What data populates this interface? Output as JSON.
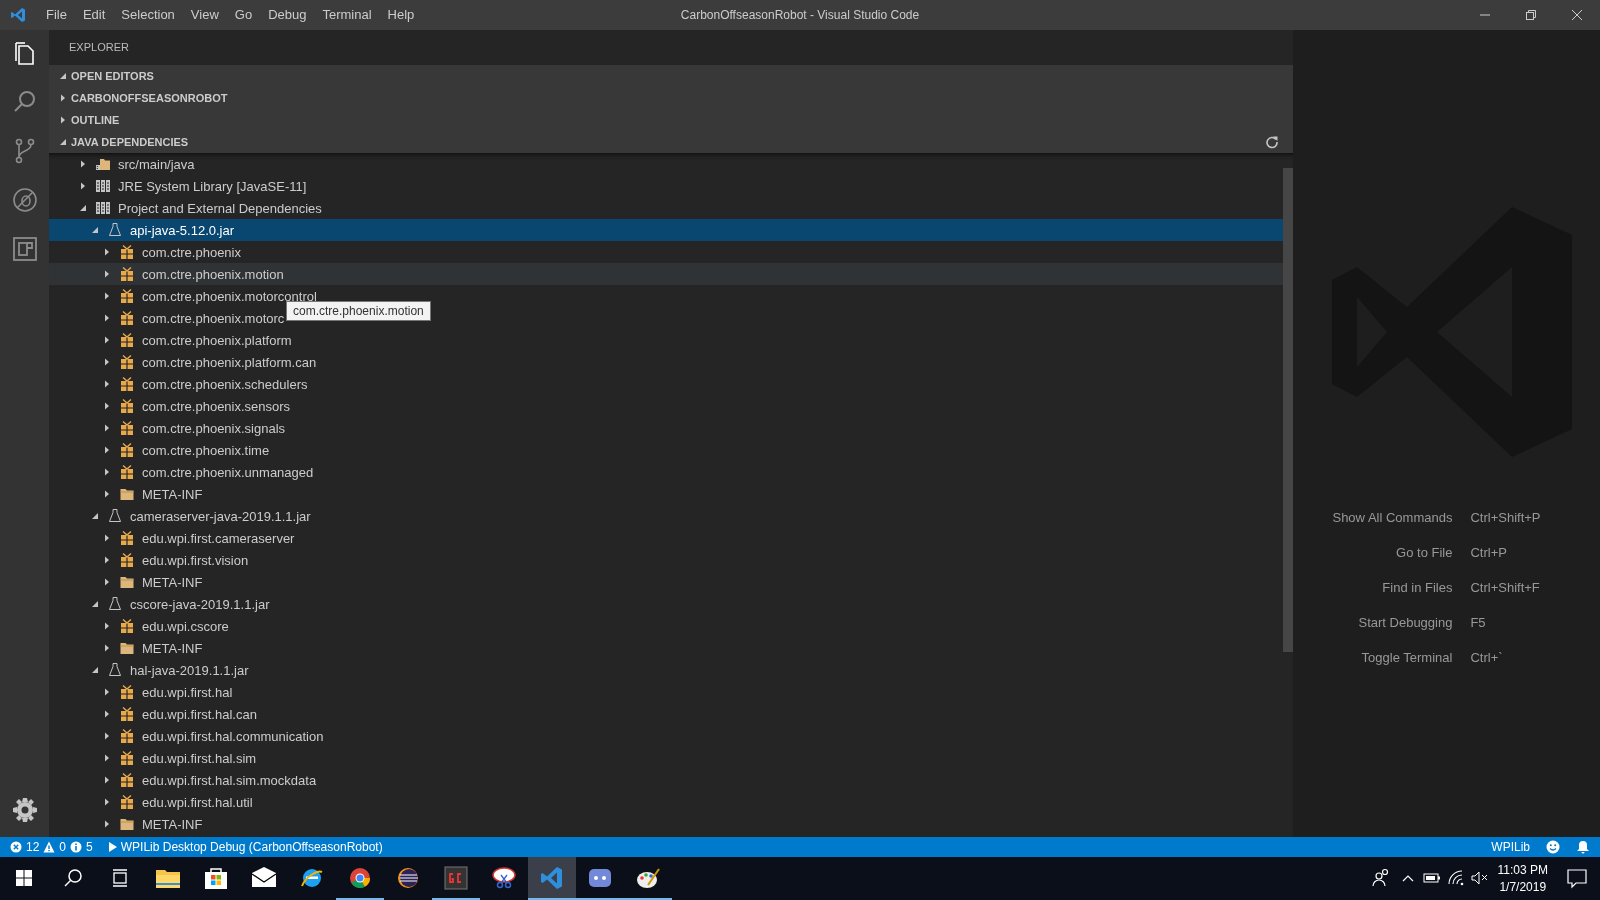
{
  "window": {
    "title": "CarbonOffseasonRobot - Visual Studio Code"
  },
  "menu": [
    "File",
    "Edit",
    "Selection",
    "View",
    "Go",
    "Debug",
    "Terminal",
    "Help"
  ],
  "activity_bar": [
    {
      "kind": "files",
      "selected": true
    },
    {
      "kind": "search",
      "selected": false
    },
    {
      "kind": "scm",
      "selected": false
    },
    {
      "kind": "debug",
      "selected": false
    },
    {
      "kind": "extensions",
      "selected": false
    }
  ],
  "sidebar": {
    "title": "EXPLORER",
    "sections": [
      {
        "label": "OPEN EDITORS",
        "expanded": true
      },
      {
        "label": "CARBONOFFSEASONROBOT",
        "expanded": false
      },
      {
        "label": "OUTLINE",
        "expanded": false
      },
      {
        "label": "JAVA DEPENDENCIES",
        "expanded": true
      }
    ],
    "tree": [
      {
        "label": "src/main/java",
        "kind": "source",
        "expanded": false,
        "selected": false,
        "hovered": false
      },
      {
        "label": "JRE System Library [JavaSE-11]",
        "kind": "library",
        "expanded": false,
        "selected": false,
        "hovered": false
      },
      {
        "label": "Project and External Dependencies",
        "kind": "library",
        "expanded": true,
        "selected": false,
        "hovered": false,
        "children": [
          {
            "label": "api-java-5.12.0.jar",
            "kind": "jar",
            "expanded": true,
            "selected": true,
            "hovered": false,
            "children": [
              {
                "label": "com.ctre.phoenix",
                "kind": "package",
                "expanded": false,
                "selected": false,
                "hovered": false
              },
              {
                "label": "com.ctre.phoenix.motion",
                "kind": "package",
                "expanded": false,
                "selected": false,
                "hovered": true
              },
              {
                "label": "com.ctre.phoenix.motorcontrol",
                "kind": "package",
                "expanded": false,
                "selected": false,
                "hovered": false
              },
              {
                "label": "com.ctre.phoenix.motorc",
                "kind": "package",
                "expanded": false,
                "selected": false,
                "hovered": false
              },
              {
                "label": "com.ctre.phoenix.platform",
                "kind": "package",
                "expanded": false,
                "selected": false,
                "hovered": false
              },
              {
                "label": "com.ctre.phoenix.platform.can",
                "kind": "package",
                "expanded": false,
                "selected": false,
                "hovered": false
              },
              {
                "label": "com.ctre.phoenix.schedulers",
                "kind": "package",
                "expanded": false,
                "selected": false,
                "hovered": false
              },
              {
                "label": "com.ctre.phoenix.sensors",
                "kind": "package",
                "expanded": false,
                "selected": false,
                "hovered": false
              },
              {
                "label": "com.ctre.phoenix.signals",
                "kind": "package",
                "expanded": false,
                "selected": false,
                "hovered": false
              },
              {
                "label": "com.ctre.phoenix.time",
                "kind": "package",
                "expanded": false,
                "selected": false,
                "hovered": false
              },
              {
                "label": "com.ctre.phoenix.unmanaged",
                "kind": "package",
                "expanded": false,
                "selected": false,
                "hovered": false
              },
              {
                "label": "META-INF",
                "kind": "folder",
                "expanded": false,
                "selected": false,
                "hovered": false
              }
            ]
          },
          {
            "label": "cameraserver-java-2019.1.1.jar",
            "kind": "jar",
            "expanded": true,
            "selected": false,
            "hovered": false,
            "children": [
              {
                "label": "edu.wpi.first.cameraserver",
                "kind": "package",
                "expanded": false,
                "selected": false,
                "hovered": false
              },
              {
                "label": "edu.wpi.first.vision",
                "kind": "package",
                "expanded": false,
                "selected": false,
                "hovered": false
              },
              {
                "label": "META-INF",
                "kind": "folder",
                "expanded": false,
                "selected": false,
                "hovered": false
              }
            ]
          },
          {
            "label": "cscore-java-2019.1.1.jar",
            "kind": "jar",
            "expanded": true,
            "selected": false,
            "hovered": false,
            "children": [
              {
                "label": "edu.wpi.cscore",
                "kind": "package",
                "expanded": false,
                "selected": false,
                "hovered": false
              },
              {
                "label": "META-INF",
                "kind": "folder",
                "expanded": false,
                "selected": false,
                "hovered": false
              }
            ]
          },
          {
            "label": "hal-java-2019.1.1.jar",
            "kind": "jar",
            "expanded": true,
            "selected": false,
            "hovered": false,
            "children": [
              {
                "label": "edu.wpi.first.hal",
                "kind": "package",
                "expanded": false,
                "selected": false,
                "hovered": false
              },
              {
                "label": "edu.wpi.first.hal.can",
                "kind": "package",
                "expanded": false,
                "selected": false,
                "hovered": false
              },
              {
                "label": "edu.wpi.first.hal.communication",
                "kind": "package",
                "expanded": false,
                "selected": false,
                "hovered": false
              },
              {
                "label": "edu.wpi.first.hal.sim",
                "kind": "package",
                "expanded": false,
                "selected": false,
                "hovered": false
              },
              {
                "label": "edu.wpi.first.hal.sim.mockdata",
                "kind": "package",
                "expanded": false,
                "selected": false,
                "hovered": false
              },
              {
                "label": "edu.wpi.first.hal.util",
                "kind": "package",
                "expanded": false,
                "selected": false,
                "hovered": false
              },
              {
                "label": "META-INF",
                "kind": "folder",
                "expanded": false,
                "selected": false,
                "hovered": false
              }
            ]
          }
        ]
      }
    ],
    "tooltip": "com.ctre.phoenix.motion"
  },
  "editor": {
    "shortcuts": [
      {
        "label": "Show All Commands",
        "keys": "Ctrl+Shift+P"
      },
      {
        "label": "Go to File",
        "keys": "Ctrl+P"
      },
      {
        "label": "Find in Files",
        "keys": "Ctrl+Shift+F"
      },
      {
        "label": "Start Debugging",
        "keys": "F5"
      },
      {
        "label": "Toggle Terminal",
        "keys": "Ctrl+`"
      }
    ]
  },
  "status_bar": {
    "errors": "12",
    "warnings": "0",
    "infos": "5",
    "launch": "WPILib Desktop Debug (CarbonOffseasonRobot)",
    "right_label": "WPILib"
  },
  "taskbar": {
    "apps": [
      {
        "kind": "folder",
        "running": false,
        "active": false
      },
      {
        "kind": "store",
        "running": false,
        "active": false
      },
      {
        "kind": "mail",
        "running": false,
        "active": false
      },
      {
        "kind": "ie",
        "running": false,
        "active": false
      },
      {
        "kind": "chrome",
        "running": true,
        "active": false
      },
      {
        "kind": "eclipse",
        "running": false,
        "active": false
      },
      {
        "kind": "gc",
        "running": true,
        "active": false
      },
      {
        "kind": "snip",
        "running": false,
        "active": false
      },
      {
        "kind": "vscode",
        "running": true,
        "active": true
      },
      {
        "kind": "discord",
        "running": true,
        "active": false
      },
      {
        "kind": "paint",
        "running": true,
        "active": false
      }
    ],
    "time": "11:03 PM",
    "date": "1/7/2019"
  }
}
